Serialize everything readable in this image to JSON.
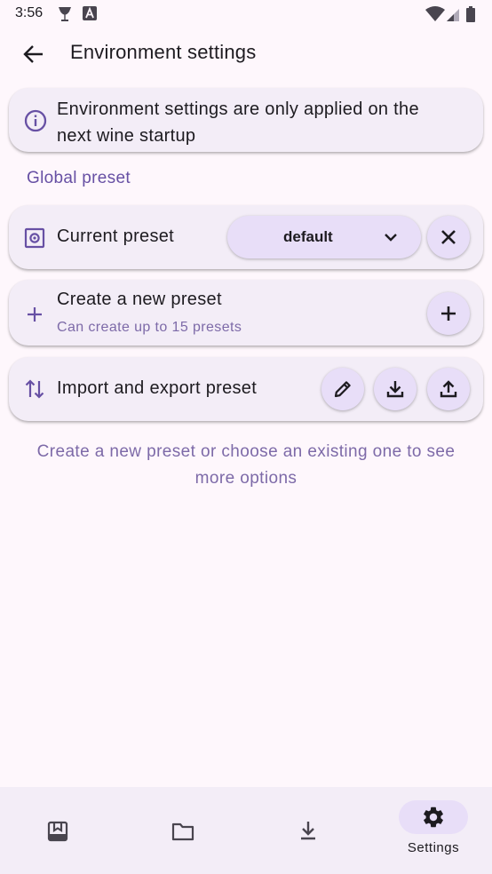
{
  "status_bar": {
    "time": "3:56",
    "icons": [
      "glass-icon",
      "a-badge-icon",
      "wifi-icon",
      "signal-icon",
      "battery-icon"
    ]
  },
  "app_bar": {
    "title": "Environment settings",
    "back_icon": "arrow-back-icon"
  },
  "info": {
    "text": "Environment settings are only applied on the next wine startup",
    "icon": "info-icon"
  },
  "section": {
    "label": "Global preset"
  },
  "current_preset": {
    "label": "Current preset",
    "icon": "settings-box-icon",
    "selected_value": "default",
    "clear_icon": "close-icon"
  },
  "create_preset": {
    "title": "Create a new preset",
    "subtitle": "Can create up to 15 presets",
    "icon": "plus-icon",
    "button_icon": "add-icon"
  },
  "import_export": {
    "label": "Import and export preset",
    "icon": "swap-vertical-icon",
    "buttons": [
      "edit-icon",
      "download-icon",
      "upload-icon"
    ]
  },
  "hint": {
    "text": "Create a new preset or choose an existing one to see more options"
  },
  "bottom_nav": {
    "items": [
      {
        "icon": "containers-icon",
        "label": ""
      },
      {
        "icon": "folder-icon",
        "label": ""
      },
      {
        "icon": "download-icon",
        "label": ""
      },
      {
        "icon": "gear-icon",
        "label": "Settings",
        "selected": true
      }
    ]
  },
  "colors": {
    "background": "#fef7fc",
    "card": "#f3edf7",
    "accent": "#6750a4",
    "tonal": "#e8def8",
    "muted_text": "#7d6aa8"
  }
}
